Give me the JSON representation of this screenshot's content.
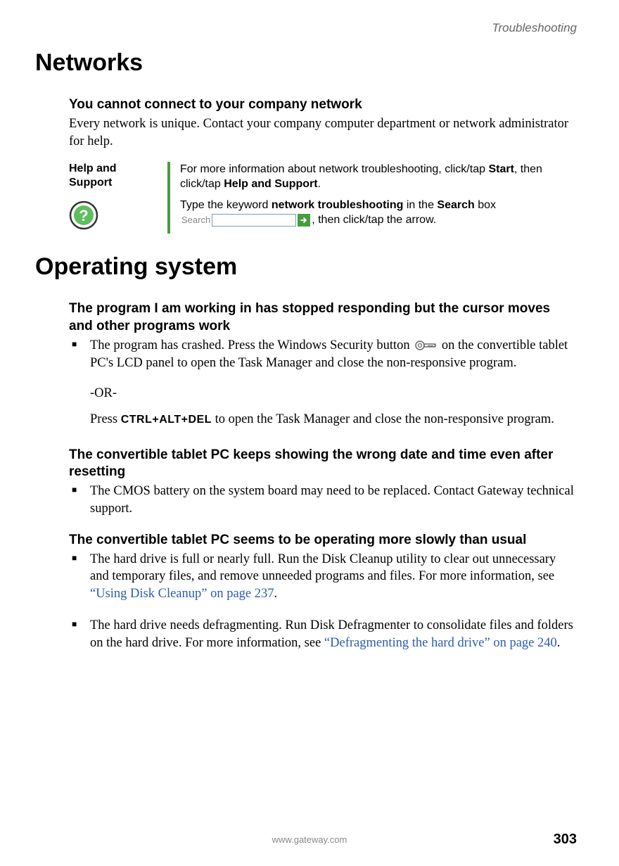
{
  "chapter": "Troubleshooting",
  "section1": {
    "title": "Networks",
    "sub1_title": "You cannot connect to your company network",
    "sub1_body": "Every network is unique. Contact your company computer department or network administrator for help."
  },
  "help": {
    "label": "Help and Support",
    "line1_a": "For more information about network troubleshooting, click/tap ",
    "line1_b": "Start",
    "line1_c": ", then click/tap ",
    "line1_d": "Help and Support",
    "line1_e": ".",
    "line2_a": "Type the keyword ",
    "line2_b": "network troubleshooting",
    "line2_c": " in the ",
    "line2_d": "Search",
    "line2_e": " box ",
    "search_label": "Search",
    "line2_f": ", then click/tap the arrow."
  },
  "section2": {
    "title": "Operating system",
    "sub1_title": "The program I am working in has stopped responding but the cursor moves and other programs work",
    "b1_a": "The program has crashed. Press the Windows Security button ",
    "b1_b": " on the convertible tablet PC's LCD panel to open the Task Manager and close the non-responsive program.",
    "or": "-OR-",
    "b1_c_a": "Press ",
    "b1_c_key": "CTRL+ALT+DEL",
    "b1_c_b": " to open the Task Manager and close the non-responsive program.",
    "sub2_title": "The convertible tablet PC keeps showing the wrong date and time even after resetting",
    "b2": "The CMOS battery on the system board may need to be replaced. Contact Gateway technical support.",
    "sub3_title": "The convertible tablet PC seems to be operating more slowly than usual",
    "b3_a": "The hard drive is full or nearly full. Run the Disk Cleanup utility to clear out unnecessary and temporary files, and remove unneeded programs and files. For more information, see ",
    "b3_link": "“Using Disk Cleanup” on page 237",
    "b3_b": ".",
    "b4_a": "The hard drive needs defragmenting. Run Disk Defragmenter to consolidate files and folders on the hard drive. For more information, see ",
    "b4_link": "“Defragmenting the hard drive” on page 240",
    "b4_b": "."
  },
  "footer": {
    "url": "www.gateway.com",
    "page": "303"
  }
}
